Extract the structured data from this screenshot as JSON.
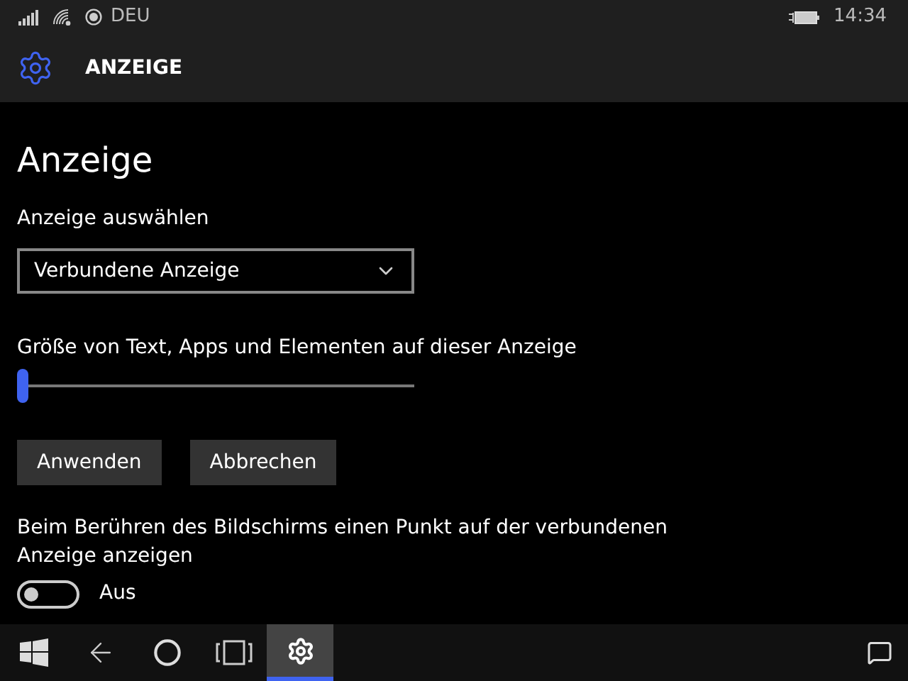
{
  "status_bar": {
    "carrier": "DEU",
    "time": "14:34"
  },
  "header": {
    "title": "ANZEIGE"
  },
  "page": {
    "heading": "Anzeige",
    "display_select": {
      "label": "Anzeige auswählen",
      "value": "Verbundene Anzeige"
    },
    "scale_slider": {
      "label": "Größe von Text, Apps und Elementen auf dieser Anzeige",
      "level": 0
    },
    "buttons": [
      "Anwenden",
      "Abbrechen"
    ],
    "touch_toggle": {
      "label": "Beim Berühren des Bildschirms einen Punkt auf der verbundenen Anzeige anzeigen",
      "on": false,
      "state_text": "Aus"
    }
  },
  "taskbar": [
    {
      "kind": "start",
      "selected": false
    },
    {
      "kind": "back",
      "selected": false
    },
    {
      "kind": "search",
      "selected": false
    },
    {
      "kind": "taskview",
      "selected": false
    },
    {
      "kind": "settings",
      "selected": true
    }
  ]
}
